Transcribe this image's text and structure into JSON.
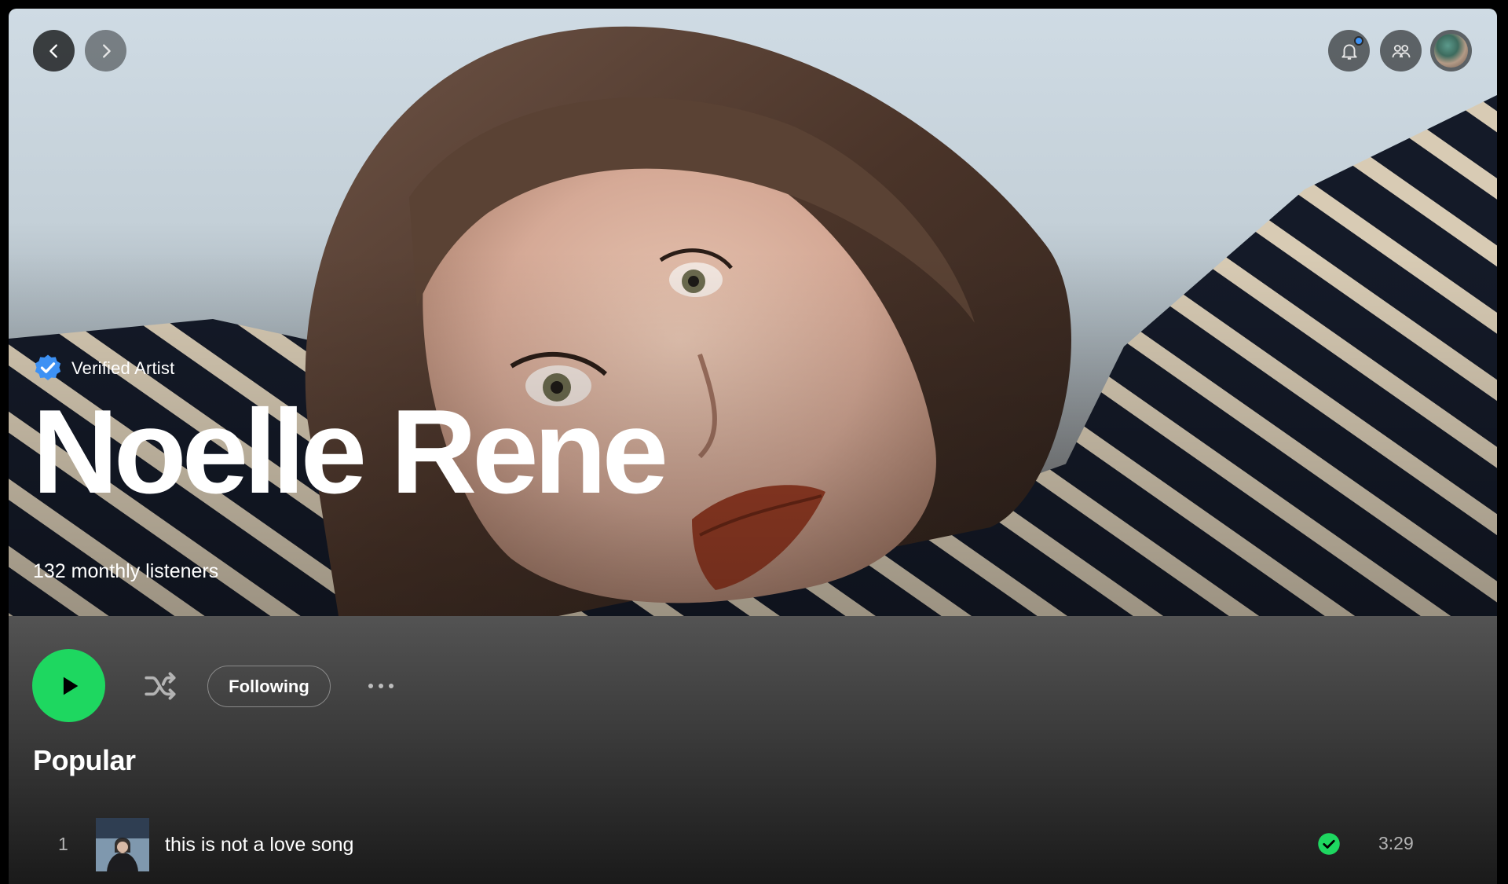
{
  "nav": {
    "back_label": "Go back",
    "forward_label": "Go forward"
  },
  "header": {
    "notifications_label": "What's New",
    "friends_label": "Friend Activity",
    "profile_label": "Profile"
  },
  "artist": {
    "verified_label": "Verified Artist",
    "name": "Noelle Rene",
    "monthly_listeners": "132 monthly listeners"
  },
  "actions": {
    "play_label": "Play",
    "shuffle_label": "Shuffle",
    "follow_label": "Following",
    "more_label": "More options"
  },
  "popular": {
    "title": "Popular",
    "tracks": [
      {
        "number": "1",
        "title": "this is not a love song",
        "saved": true,
        "duration": "3:29"
      }
    ]
  },
  "colors": {
    "accent": "#1ed760",
    "verified_badge": "#3d91f4",
    "notification_dot": "#3d91f4"
  },
  "icons": {
    "back": "chevron-left-icon",
    "forward": "chevron-right-icon",
    "notifications": "bell-icon",
    "friends": "friends-icon",
    "verified": "verified-badge-icon",
    "play": "play-icon",
    "shuffle": "shuffle-icon",
    "more": "more-dots-icon",
    "saved": "check-circle-icon"
  }
}
